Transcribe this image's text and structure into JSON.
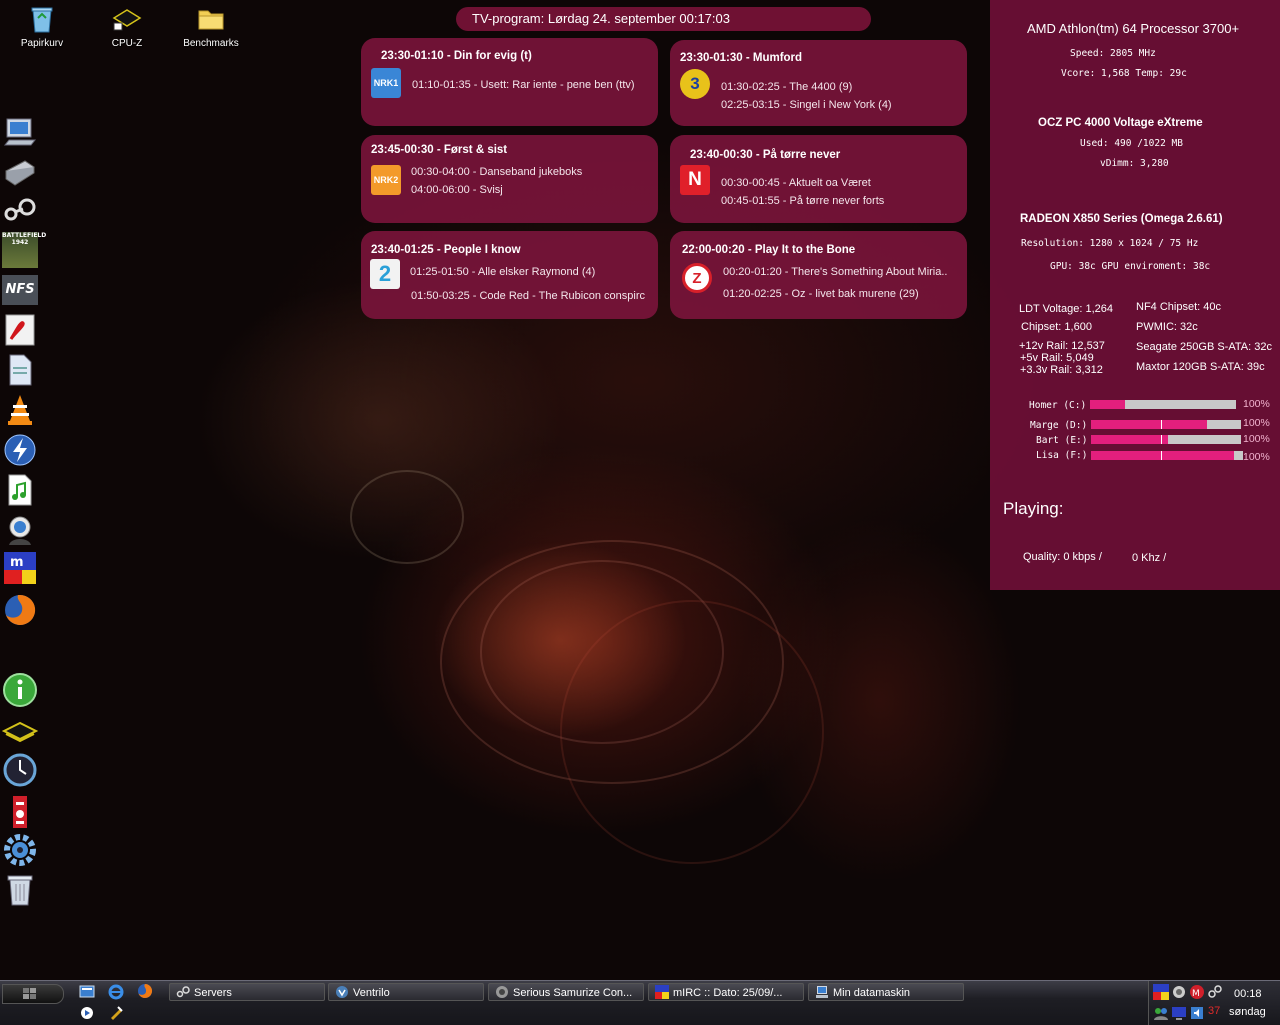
{
  "desktop": {
    "icons": [
      {
        "label": "Papirkurv",
        "icon": "recycle-bin-icon"
      },
      {
        "label": "CPU-Z",
        "icon": "chip-icon"
      },
      {
        "label": "Benchmarks",
        "icon": "folder-icon"
      }
    ],
    "side_icons": [
      "my-computer-icon",
      "scanner-icon",
      "steam-icon",
      "battlefield-icon",
      "nfs-icon",
      "acrobat-icon",
      "document-icon",
      "vlc-icon",
      "lightning-icon",
      "music-icon",
      "messenger-icon",
      "mirc-icon",
      "firefox-icon",
      "info-icon",
      "chip-icon",
      "clock-icon",
      "hardware-icon",
      "gear-icon",
      "recycle-bin-icon"
    ],
    "side_icon_text": {
      "battlefield": "BATTLEFIELD 1942",
      "nfs": "NFS"
    }
  },
  "tv": {
    "header": "TV-program: Lørdag 24. september 00:17:03",
    "channels": [
      {
        "now": "23:30-01:10 - Din for evig (t)",
        "logo": "NRK1",
        "logo_color": "#3a86d6",
        "next1": "01:10-01:35 - Usett: Rar iente - pene ben (ttv)",
        "next2": ""
      },
      {
        "now": "23:30-01:30 - Mumford",
        "logo": "3",
        "logo_color": "#e8c21a",
        "next1": "01:30-02:25 - The 4400 (9)",
        "next2": "02:25-03:15 - Singel i New York (4)"
      },
      {
        "now": "23:45-00:30 - Først & sist",
        "logo": "NRK2",
        "logo_color": "#f39a2a",
        "next1": "00:30-04:00 - Danseband jukeboks",
        "next2": "04:00-06:00 - Svisj"
      },
      {
        "now": "23:40-00:30 - På tørre never",
        "logo": "N",
        "logo_color": "#e0202a",
        "next1": "00:30-00:45 - Aktuelt oa Været",
        "next2": "00:45-01:55 - På tørre never forts"
      },
      {
        "now": "23:40-01:25 - People I know",
        "logo": "2",
        "logo_color": "#f2f2f2",
        "next1": "01:25-01:50 - Alle elsker Raymond (4)",
        "next2": "01:50-03:25 - Code Red - The Rubicon conspirc"
      },
      {
        "now": "22:00-00:20 - Play It to the Bone",
        "logo": "Z",
        "logo_color": "#d8202a",
        "next1": "00:20-01:20 - There's Something About Miria..",
        "next2": "01:20-02:25 - Oz - livet bak murene (29)"
      }
    ]
  },
  "sys": {
    "cpu_name": "AMD Athlon(tm) 64 Processor 3700+",
    "cpu_speed": "Speed: 2805 MHz",
    "cpu_vcore": "Vcore: 1,568  Temp: 29c",
    "ram_name": "OCZ PC 4000 Voltage eXtreme",
    "ram_used": "Used: 490 /1022 MB",
    "ram_vdimm": "vDimm: 3,280",
    "gpu_name": "RADEON X850 Series (Omega 2.6.61)",
    "gpu_res": "Resolution:  1280 x 1024  /  75 Hz",
    "gpu_temp": "GPU: 38c   GPU enviroment: 38c",
    "left_stats": [
      "LDT Voltage: 1,264",
      "Chipset: 1,600",
      "+12v Rail: 12,537",
      "+5v Rail: 5,049",
      "+3.3v Rail: 3,312"
    ],
    "right_stats": [
      "NF4 Chipset: 40c",
      "PWMIC: 32c",
      "Seagate 250GB S-ATA: 32c",
      "Maxtor 120GB S-ATA: 39c"
    ],
    "drives": [
      {
        "label": "Homer (C:)",
        "pct": "100%",
        "fill": 0.24
      },
      {
        "label": "Marge (D:)",
        "pct": "100%",
        "fill": 0.77
      },
      {
        "label": "Bart (E:)",
        "pct": "100%",
        "fill": 0.51
      },
      {
        "label": "Lisa (F:)",
        "pct": "100%",
        "fill": 0.94
      }
    ],
    "playing": "Playing:",
    "quality": "Quality: 0 kbps  /",
    "khz": "0 Khz /",
    "accent": "#e31f7d"
  },
  "taskbar": {
    "tasks": [
      {
        "label": "Servers",
        "icon": "steam-icon"
      },
      {
        "label": "Ventrilo",
        "icon": "ventrilo-icon"
      },
      {
        "label": "Serious Samurize Con...",
        "icon": "samurize-icon"
      },
      {
        "label": "mIRC :: Dato: 25/09/...",
        "icon": "mirc-icon"
      },
      {
        "label": "Min datamaskin",
        "icon": "my-computer-icon"
      }
    ],
    "clock_time": "00:18",
    "clock_day": "søndag",
    "tray_number": "37"
  }
}
